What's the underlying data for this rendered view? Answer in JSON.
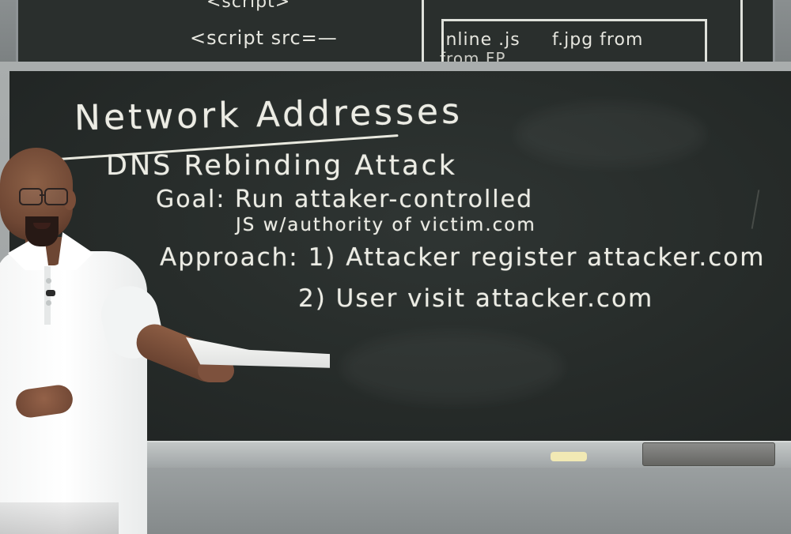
{
  "scene": {
    "upper_board": {
      "left_lines": [
        "<script>",
        "<script src=—"
      ],
      "box_lines": [
        "Inline .js",
        "f.jpg from",
        "from FP"
      ]
    },
    "main_board": {
      "title": "Network Addresses",
      "subtitle": "DNS Rebinding Attack",
      "goal_line": "Goal: Run attaker-controlled",
      "goal_detail": "JS w/authority of victim.com",
      "approach_1": "Approach: 1) Attacker register attacker.com",
      "approach_2": "2) User visit attacker.com"
    }
  }
}
